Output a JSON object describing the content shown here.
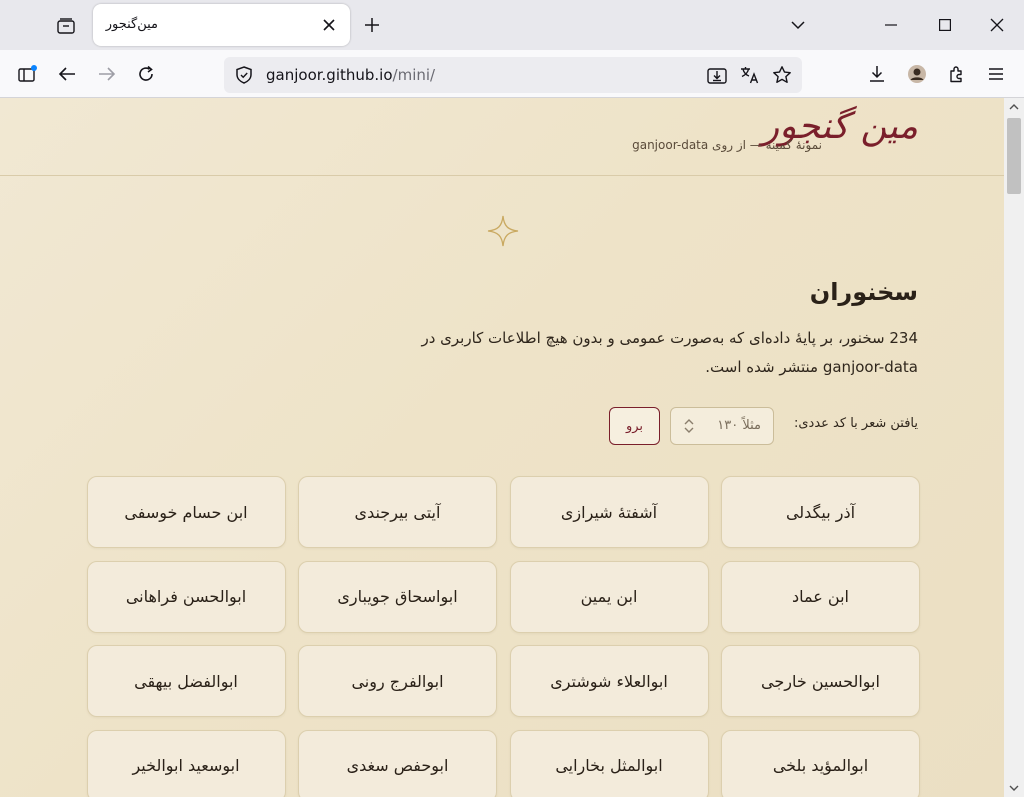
{
  "browser": {
    "tab_title": "مین‌گنجور",
    "url_host": "ganjoor.github.io",
    "url_path": "/mini/"
  },
  "site": {
    "logo": "مین گنجور",
    "tagline": "نمونهٔ کمینه — از روی ganjoor-data"
  },
  "main": {
    "title": "سخنوران",
    "description": "234 سخنور، بر پایهٔ داده‌ای که به‌صورت عمومی و بدون هیچ اطلاعات کاربری در ganjoor-data منتشر شده است.",
    "find_label": "یافتن شعر با کد عددی:",
    "find_placeholder": "مثلاً ۱۳۰",
    "go_label": "برو"
  },
  "poets": [
    "آذر بیگدلی",
    "آشفتهٔ شیرازی",
    "آیتی بیرجندی",
    "ابن حسام خوسفی",
    "ابن عماد",
    "ابن یمین",
    "ابواسحاق جویباری",
    "ابوالحسن فراهانی",
    "ابوالحسین خارجی",
    "ابوالعلاء شوشتری",
    "ابوالفرج رونی",
    "ابوالفضل بیهقی",
    "ابوالمؤید بلخی",
    "ابوالمثل بخارایی",
    "ابوحفص سغدی",
    "ابوسعید ابوالخیر"
  ],
  "colors": {
    "accent": "#7a1f2b",
    "page_bg": "#efe5cd",
    "card_bg": "#f3ebdb"
  },
  "icons": {
    "tab_list": "tab-list-icon",
    "close": "close-icon",
    "new_tab": "plus-icon",
    "back": "arrow-left-icon",
    "forward": "arrow-right-icon",
    "reload": "reload-icon"
  }
}
